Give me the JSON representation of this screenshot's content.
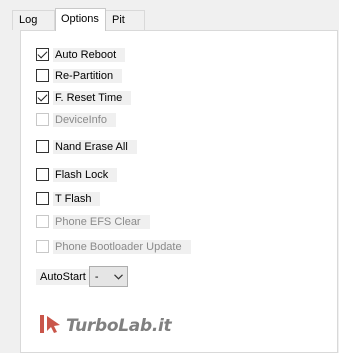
{
  "tabs": [
    {
      "label": "Log"
    },
    {
      "label": "Options"
    },
    {
      "label": "Pit"
    }
  ],
  "options": [
    {
      "label": "Auto Reboot",
      "checked": true,
      "enabled": true
    },
    {
      "label": "Re-Partition",
      "checked": false,
      "enabled": true
    },
    {
      "label": "F. Reset Time",
      "checked": true,
      "enabled": true
    },
    {
      "label": "DeviceInfo",
      "checked": false,
      "enabled": false
    },
    {
      "label": "Nand Erase All",
      "checked": false,
      "enabled": true
    },
    {
      "label": "Flash Lock",
      "checked": false,
      "enabled": true
    },
    {
      "label": "T Flash",
      "checked": false,
      "enabled": true
    },
    {
      "label": "Phone EFS Clear",
      "checked": false,
      "enabled": false
    },
    {
      "label": "Phone Bootloader Update",
      "checked": false,
      "enabled": false
    }
  ],
  "autostart": {
    "label": "AutoStart",
    "selected": "-"
  },
  "watermark": {
    "text": "TurboLab.it"
  },
  "colors": {
    "accent_red": "#c0392b",
    "panel_bg": "#ffffff",
    "window_bg": "#f0f0f0"
  }
}
